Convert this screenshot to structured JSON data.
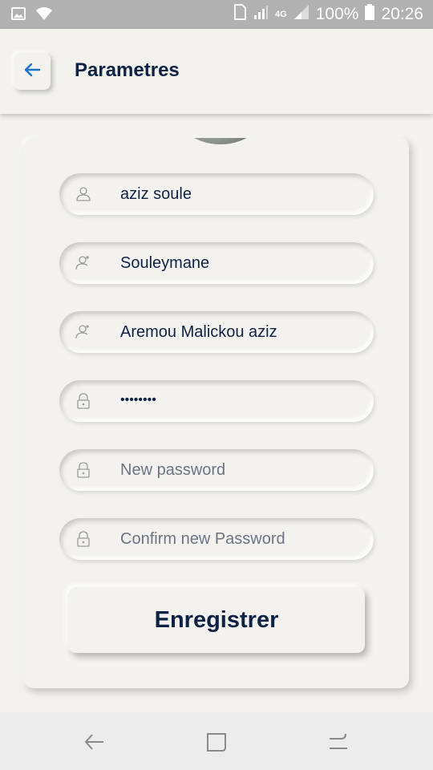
{
  "status_bar": {
    "battery": "100%",
    "time": "20:26",
    "network": "4G",
    "icons": [
      "image-icon",
      "wifi-icon",
      "sim-icon",
      "signal-icon",
      "battery-icon"
    ]
  },
  "header": {
    "title": "Parametres",
    "back_icon": "arrow-left-icon"
  },
  "form": {
    "fields": [
      {
        "icon": "user-icon",
        "value": "aziz soule",
        "placeholder": ""
      },
      {
        "icon": "user-edit-icon",
        "value": "Souleymane",
        "placeholder": ""
      },
      {
        "icon": "user-edit-icon",
        "value": "Aremou Malickou aziz",
        "placeholder": ""
      },
      {
        "icon": "lock-icon",
        "value": "••••••••",
        "placeholder": ""
      },
      {
        "icon": "lock-icon",
        "value": "",
        "placeholder": "New password"
      },
      {
        "icon": "lock-icon",
        "value": "",
        "placeholder": "Confirm new Password"
      }
    ],
    "save_label": "Enregistrer"
  },
  "nav_bar": {
    "items": [
      "back-nav-icon",
      "recents-nav-icon",
      "menu-nav-icon"
    ]
  },
  "colors": {
    "background": "#f3f2ef",
    "text": "#0e2245",
    "accent": "#1a73c8",
    "placeholder": "#6c7483"
  }
}
